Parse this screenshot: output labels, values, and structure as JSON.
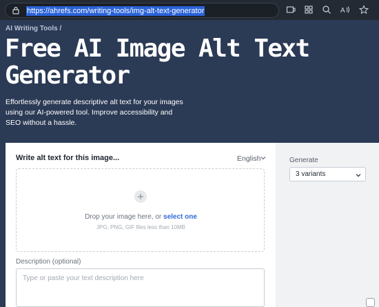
{
  "browser": {
    "url": "https://ahrefs.com/writing-tools/img-alt-text-generator",
    "icons": [
      "lock-icon",
      "tab-icon",
      "grid-icon",
      "zoom-icon",
      "read-aloud-icon",
      "favorite-icon"
    ]
  },
  "hero": {
    "breadcrumb": "AI Writing Tools /",
    "title": "Free AI Image Alt Text Generator",
    "description": "Effortlessly generate descriptive alt text for your images using our AI-powered tool. Improve accessibility and SEO without a hassle."
  },
  "tool": {
    "heading": "Write alt text for this image...",
    "language": "English",
    "upload": {
      "prompt": "Drop your image here, or",
      "link": "select one",
      "hint": "JPG, PNG, GIF files less than 10MB"
    },
    "description_label": "Description (optional)",
    "description_placeholder": "Type or paste your text description here"
  },
  "sidebar": {
    "generate_label": "Generate",
    "variants_value": "3 variants"
  },
  "colors": {
    "hero_bg": "#2b3a55",
    "url_highlight": "#2a62d8",
    "link": "#2f6bd8"
  }
}
